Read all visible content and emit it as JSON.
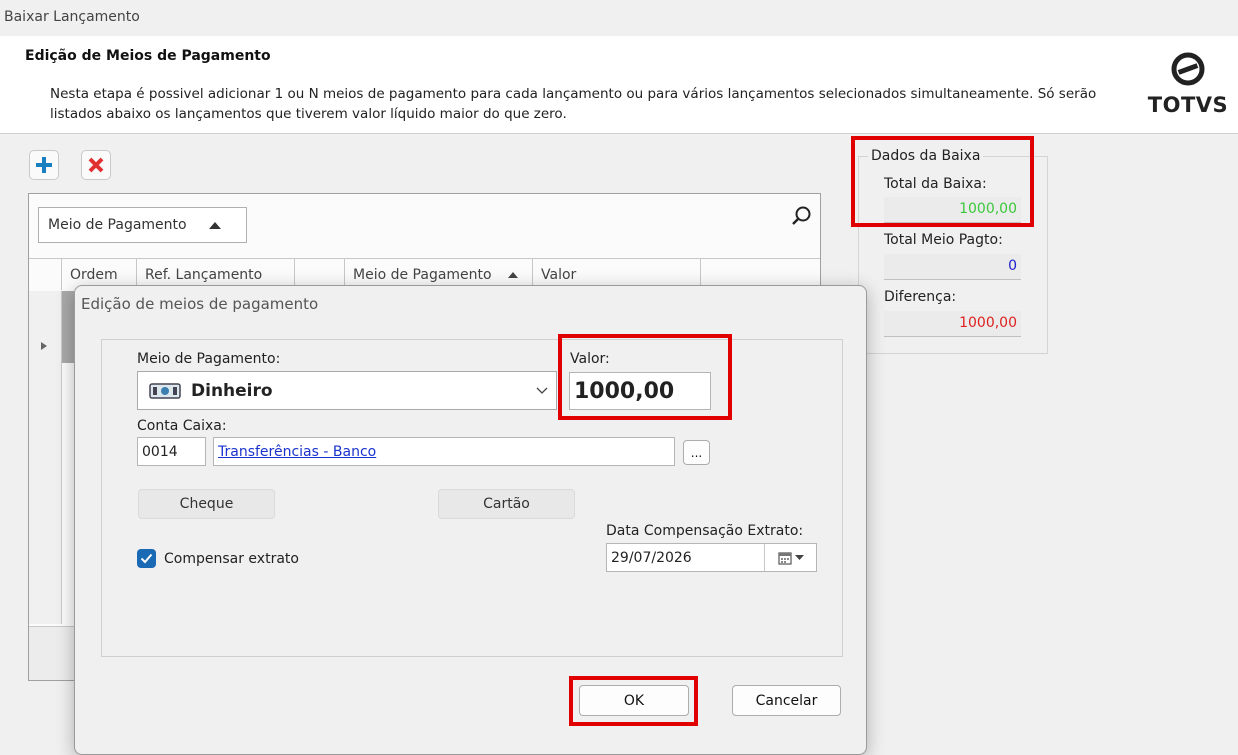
{
  "window": {
    "title": "Baixar Lançamento"
  },
  "header": {
    "title": "Edição de Meios de Pagamento",
    "description": "Nesta etapa é possivel adicionar 1 ou N meios de pagamento para cada lançamento ou para vários lançamentos selecionados simultaneamente. Só serão listados abaixo os lançamentos que tiverem valor líquido maior do que zero.",
    "logo_text": "TOTVS"
  },
  "grid": {
    "group_by": "Meio de Pagamento",
    "columns": [
      "Ordem",
      "Ref. Lançamento",
      "",
      "Meio de Pagamento",
      "Valor",
      ""
    ]
  },
  "summary": {
    "title": "Dados da Baixa",
    "total_baixa_label": "Total da Baixa:",
    "total_baixa_value": "1000,00",
    "total_meio_label": "Total Meio Pagto:",
    "total_meio_value": "0",
    "diferenca_label": "Diferença:",
    "diferenca_value": "1000,00",
    "colors": {
      "total_baixa": "#3cc83c",
      "total_meio": "#2020d0",
      "diferenca": "#e02020"
    }
  },
  "dialog": {
    "title": "Edição de meios de pagamento",
    "meio_label": "Meio de Pagamento:",
    "meio_value": "Dinheiro",
    "valor_label": "Valor:",
    "valor_value": "1000,00",
    "conta_label": "Conta Caixa:",
    "conta_code": "0014",
    "conta_name": "Transferências - Banco",
    "browse_label": "...",
    "cheque_label": "Cheque",
    "cartao_label": "Cartão",
    "data_label": "Data Compensação Extrato:",
    "data_value": "29/07/2026",
    "compensar_label": "Compensar extrato",
    "compensar_checked": true,
    "ok_label": "OK",
    "cancel_label": "Cancelar"
  }
}
